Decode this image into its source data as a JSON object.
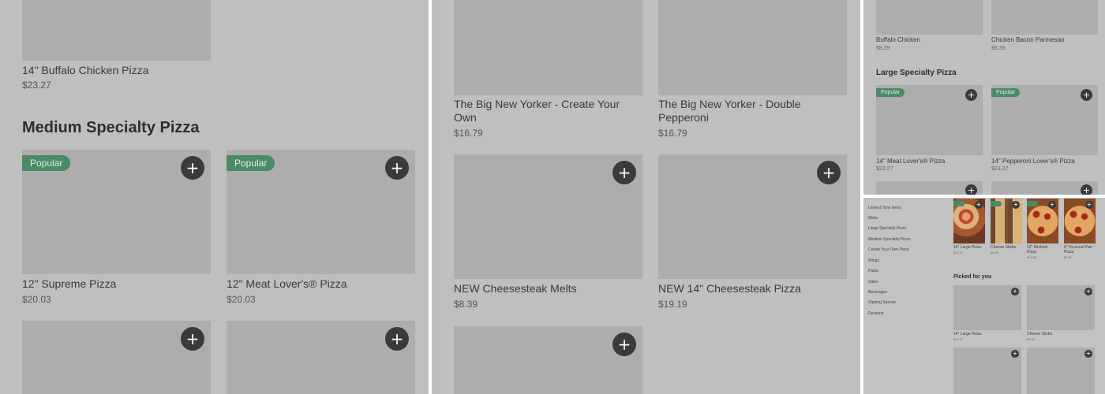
{
  "panel1": {
    "top_item": {
      "name": "14\" Buffalo Chicken Pizza",
      "price": "$23.27"
    },
    "section_title": "Medium Specialty Pizza",
    "items": [
      {
        "name": "12\" Supreme Pizza",
        "price": "$20.03",
        "badge": "Popular"
      },
      {
        "name": "12\" Meat Lover's® Pizza",
        "price": "$20.03",
        "badge": "Popular"
      }
    ],
    "add_icon": "+"
  },
  "panel2": {
    "items": [
      {
        "name": "The Big New Yorker - Create Your Own",
        "price": "$16.79"
      },
      {
        "name": "The Big New Yorker - Double Pepperoni",
        "price": "$16.79"
      },
      {
        "name": "NEW Cheesesteak Melts",
        "price": "$8.39"
      },
      {
        "name": "NEW 14\" Cheesesteak Pizza",
        "price": "$19.19"
      }
    ],
    "add_icon": "+"
  },
  "panel3": {
    "top_items": [
      {
        "name": "Buffalo Chicken",
        "price": "$8.39"
      },
      {
        "name": "Chicken Bacon Parmesan",
        "price": "$8.39"
      }
    ],
    "section_title": "Large Specialty Pizza",
    "items": [
      {
        "name": "14\" Meat Lover's® Pizza",
        "price": "$23.27",
        "badge": "Popular"
      },
      {
        "name": "14\" Pepperoni Lover's® Pizza",
        "price": "$23.27",
        "badge": "Popular"
      }
    ],
    "add_icon": "+"
  },
  "panel4": {
    "nav": [
      "Limited Time Items",
      "Melts",
      "Large Specialty Pizza",
      "Medium Specialty Pizza",
      "Create Your Own Pizza",
      "Wings",
      "Pasta",
      "Sides",
      "Beverages",
      "Dipping Sauces",
      "Desserts"
    ],
    "featured": [
      {
        "name": "14\" Large Pizza",
        "price": "$17.27"
      },
      {
        "name": "Cheese Sticks",
        "price": "$9.59"
      },
      {
        "name": "12\" Medium Pizza",
        "price": "$14.63"
      },
      {
        "name": "6\" Personal Pan Pizza",
        "price": "$7.91"
      }
    ],
    "section_title": "Picked for you",
    "picked": [
      {
        "name": "14\" Large Pizza",
        "price": "$17.27"
      },
      {
        "name": "Cheese Sticks",
        "price": "$9.59"
      }
    ],
    "add_icon": "+"
  }
}
